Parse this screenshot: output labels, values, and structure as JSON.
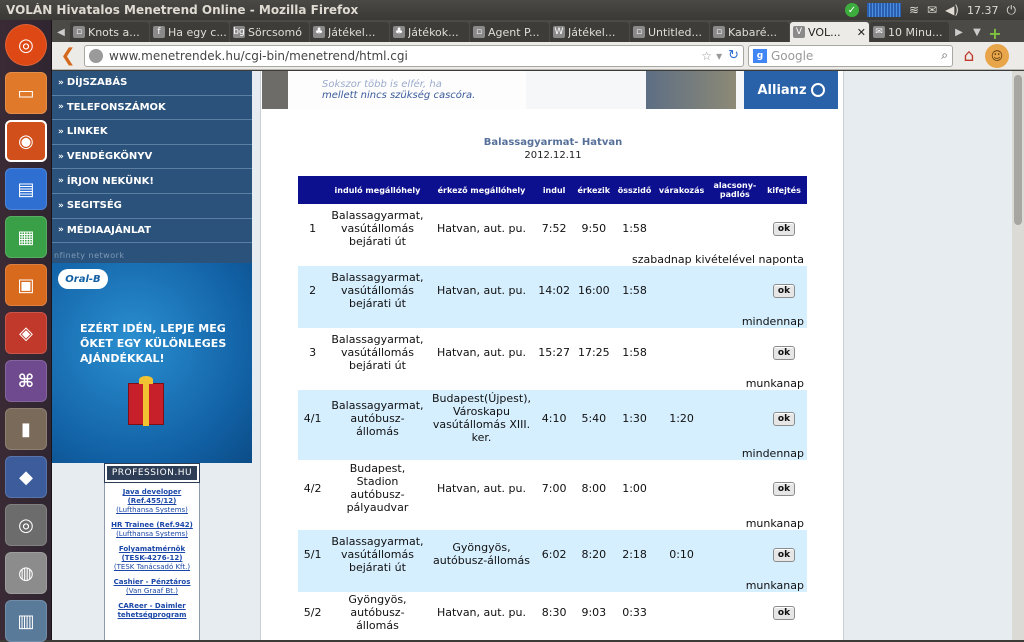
{
  "window": {
    "title": "VOLÁN Hivatalos Menetrend Online - Mozilla Firefox",
    "time": "17.37"
  },
  "tabs": [
    {
      "label": "Knots a...",
      "icon": "page-icon"
    },
    {
      "label": "Ha egy c...",
      "icon": "facebook-icon"
    },
    {
      "label": "Sörcsomó",
      "icon": "bg-icon"
    },
    {
      "label": "Játékel...",
      "icon": "game-icon"
    },
    {
      "label": "Játékok...",
      "icon": "game-icon"
    },
    {
      "label": "Agent P...",
      "icon": "page-icon"
    },
    {
      "label": "Játékel...",
      "icon": "wikipedia-icon"
    },
    {
      "label": "Untitled...",
      "icon": "page-icon"
    },
    {
      "label": "Kabaré...",
      "icon": "page-icon"
    },
    {
      "label": "VOL...",
      "icon": "volan-icon",
      "active": true
    },
    {
      "label": "10 Minu...",
      "icon": "mail-icon"
    }
  ],
  "nav": {
    "url": "www.menetrendek.hu/cgi-bin/menetrend/html.cgi",
    "search_placeholder": "Google",
    "search_engine_letter": "g"
  },
  "sidebar": {
    "menu": [
      {
        "label": "DÍJSZABÁS"
      },
      {
        "label": "TELEFONSZÁMOK"
      },
      {
        "label": "LINKEK"
      },
      {
        "label": "VENDÉGKÖNYV"
      },
      {
        "label": "ÍRJON NEKÜNK!"
      },
      {
        "label": "SEGITSÉG"
      },
      {
        "label": "MÉDIAAJÁNLAT"
      }
    ],
    "network_text": "nfinety network",
    "oralb": {
      "logo": "Oral-B",
      "slogan": "EZÉRT IDÉN, LEPJE MEG ŐKET EGY KÜLÖNLEGES AJÁNDÉKKAL!"
    },
    "profession": {
      "header": "PROFESSION.HU",
      "jobs": [
        {
          "title": "Java developer (Ref.455/12)",
          "company": "(Lufthansa Systems)"
        },
        {
          "title": "HR Trainee (Ref.942)",
          "company": "(Lufthansa Systems)"
        },
        {
          "title": "Folyamatmérnök (TESK-4276-12)",
          "company": "(TESK Tanácsadó Kft.)"
        },
        {
          "title": "Cashier - Pénztáros",
          "company": "(Van Graaf Bt.)"
        },
        {
          "title": "CAReer - Daimler tehetségprogram",
          "company": ""
        }
      ]
    }
  },
  "banner": {
    "slogan_line1": "Sokszor több is elfér, ha",
    "slogan_line2": "mellett nincs szükség cascóra.",
    "brand": "Allianz"
  },
  "route": {
    "name": "Balassagyarmat- Hatvan",
    "date": "2012.12.11"
  },
  "table": {
    "headers": [
      "",
      "induló megállóhely",
      "érkező megállóhely",
      "indul",
      "érkezik",
      "összidő",
      "várakozás",
      "alacsony-padlós",
      "kifejtés"
    ],
    "ok_label": "ok",
    "rows": [
      {
        "num": "1",
        "from": "Balassagyarmat, vasútállomás bejárati út",
        "to": "Hatvan, aut. pu.",
        "dep": "7:52",
        "arr": "9:50",
        "total": "1:58",
        "wait": "",
        "note": "szabadnap kivételével naponta"
      },
      {
        "num": "2",
        "from": "Balassagyarmat, vasútállomás bejárati út",
        "to": "Hatvan, aut. pu.",
        "dep": "14:02",
        "arr": "16:00",
        "total": "1:58",
        "wait": "",
        "note": "mindennap"
      },
      {
        "num": "3",
        "from": "Balassagyarmat, vasútállomás bejárati út",
        "to": "Hatvan, aut. pu.",
        "dep": "15:27",
        "arr": "17:25",
        "total": "1:58",
        "wait": "",
        "note": "munkanap"
      },
      {
        "num": "4/1",
        "from": "Balassagyarmat, autóbusz-állomás",
        "to": "Budapest(Újpest), Városkapu vasútállomás XIII. ker.",
        "dep": "4:10",
        "arr": "5:40",
        "total": "1:30",
        "wait": "1:20",
        "note": "mindennap"
      },
      {
        "num": "4/2",
        "from": "Budapest, Stadion autóbusz-pályaudvar",
        "to": "Hatvan, aut. pu.",
        "dep": "7:00",
        "arr": "8:00",
        "total": "1:00",
        "wait": "",
        "note": "munkanap"
      },
      {
        "num": "5/1",
        "from": "Balassagyarmat, vasútállomás bejárati út",
        "to": "Gyöngyös, autóbusz-állomás",
        "dep": "6:02",
        "arr": "8:20",
        "total": "2:18",
        "wait": "0:10",
        "note": "munkanap"
      },
      {
        "num": "5/2",
        "from": "Gyöngyös, autóbusz-állomás",
        "to": "Hatvan, aut. pu.",
        "dep": "8:30",
        "arr": "9:03",
        "total": "0:33",
        "wait": "",
        "note": ""
      }
    ]
  }
}
